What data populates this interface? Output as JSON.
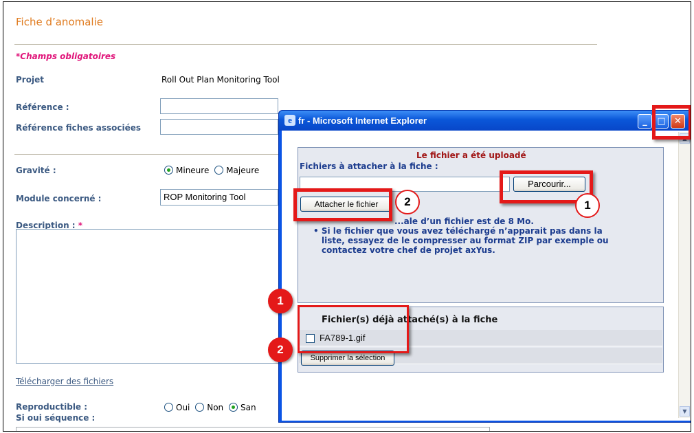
{
  "form": {
    "title": "Fiche d’anomalie",
    "required_note": "*Champs obligatoires",
    "projet_label": "Projet",
    "projet_value": "Roll Out Plan Monitoring Tool",
    "reference_label": "Référence :",
    "ref_associees_label": "Référence fiches associées",
    "gravite_label": "Gravité :",
    "gravite_options": [
      "Mineure",
      "Majeure"
    ],
    "gravite_selected": "Mineure",
    "module_label": "Module concerné :",
    "module_value": "ROP Monitoring Tool",
    "description_label": "Description :",
    "description_star": "*",
    "download_link": "Télécharger des fichiers",
    "reproductible_label": "Reproductible :",
    "reproductible_options": [
      "Oui",
      "Non",
      "San"
    ],
    "reproductible_selected": "San",
    "sequence_label": "Si oui séquence :"
  },
  "popup": {
    "title": "fr - Microsoft Internet Explorer",
    "uploaded_msg": "Le fichier a été uploadé",
    "files_label": "Fichiers à attacher à la fiche :",
    "browse_button": "Parcourir...",
    "attach_button": "Attacher le fichier",
    "max_size_note": "...ale d’un fichier est de 8 Mo.",
    "hint_line1": "Si le fichier que vous avez téléchargé n’apparait pas dans la",
    "hint_line2": "liste, essayez de le compresser au format ZIP par exemple ou",
    "hint_line3": "contactez votre chef de projet axYus.",
    "attached_header": "Fichier(s) déjà attaché(s) à la fiche",
    "attached_files": [
      "FA789-1.gif"
    ],
    "delete_button": "Supprimer la sélection"
  },
  "annotations": {
    "browse_badge": "1",
    "attach_badge": "2",
    "file_badge": "1",
    "delete_badge": "2"
  },
  "colors": {
    "title_orange": "#e07b1f",
    "required_pink": "#e0157a",
    "label_blue": "#3c5a82",
    "annotation_red": "#e41919",
    "xp_blue": "#0a57d9"
  }
}
